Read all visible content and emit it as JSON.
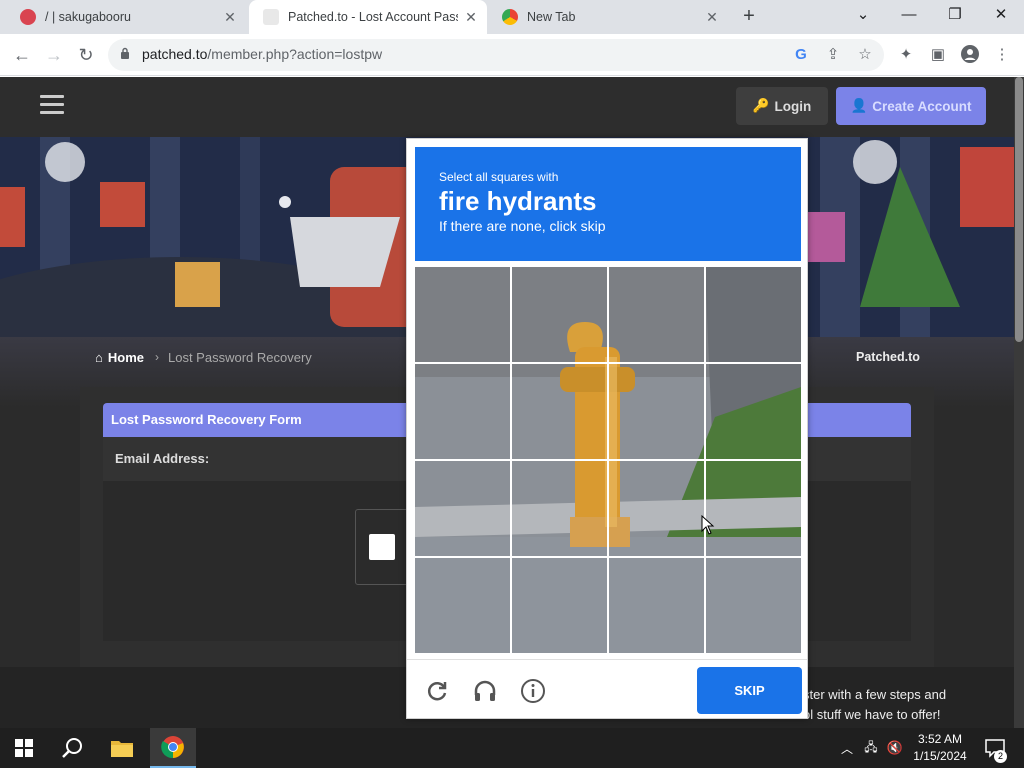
{
  "browser": {
    "tabs": [
      {
        "title": "/ | sakugabooru",
        "icon": "sakugabooru-favicon"
      },
      {
        "title": "Patched.to - Lost Account Passw",
        "icon": "patched-favicon",
        "active": true
      },
      {
        "title": "New Tab",
        "icon": "chrome-favicon"
      }
    ],
    "url_domain": "patched.to",
    "url_path": "/member.php?action=lostpw"
  },
  "site": {
    "nav": {
      "login": "Login",
      "create_account": "Create Account"
    },
    "breadcrumb": {
      "home": "Home",
      "current": "Lost Password Recovery",
      "site": "Patched.to"
    },
    "form": {
      "header": "Lost Password Recovery Form",
      "email_label": "Email Address:"
    },
    "footer": {
      "line1": "ster with a few steps and",
      "line2": "ol stuff we have to offer!"
    }
  },
  "captcha": {
    "instruction_small": "Select all squares with",
    "target": "fire hydrants",
    "instruction_sub": "If there are none, click skip",
    "skip_label": "SKIP"
  },
  "taskbar": {
    "time": "3:52 AM",
    "date": "1/15/2024",
    "notifications": "2"
  }
}
